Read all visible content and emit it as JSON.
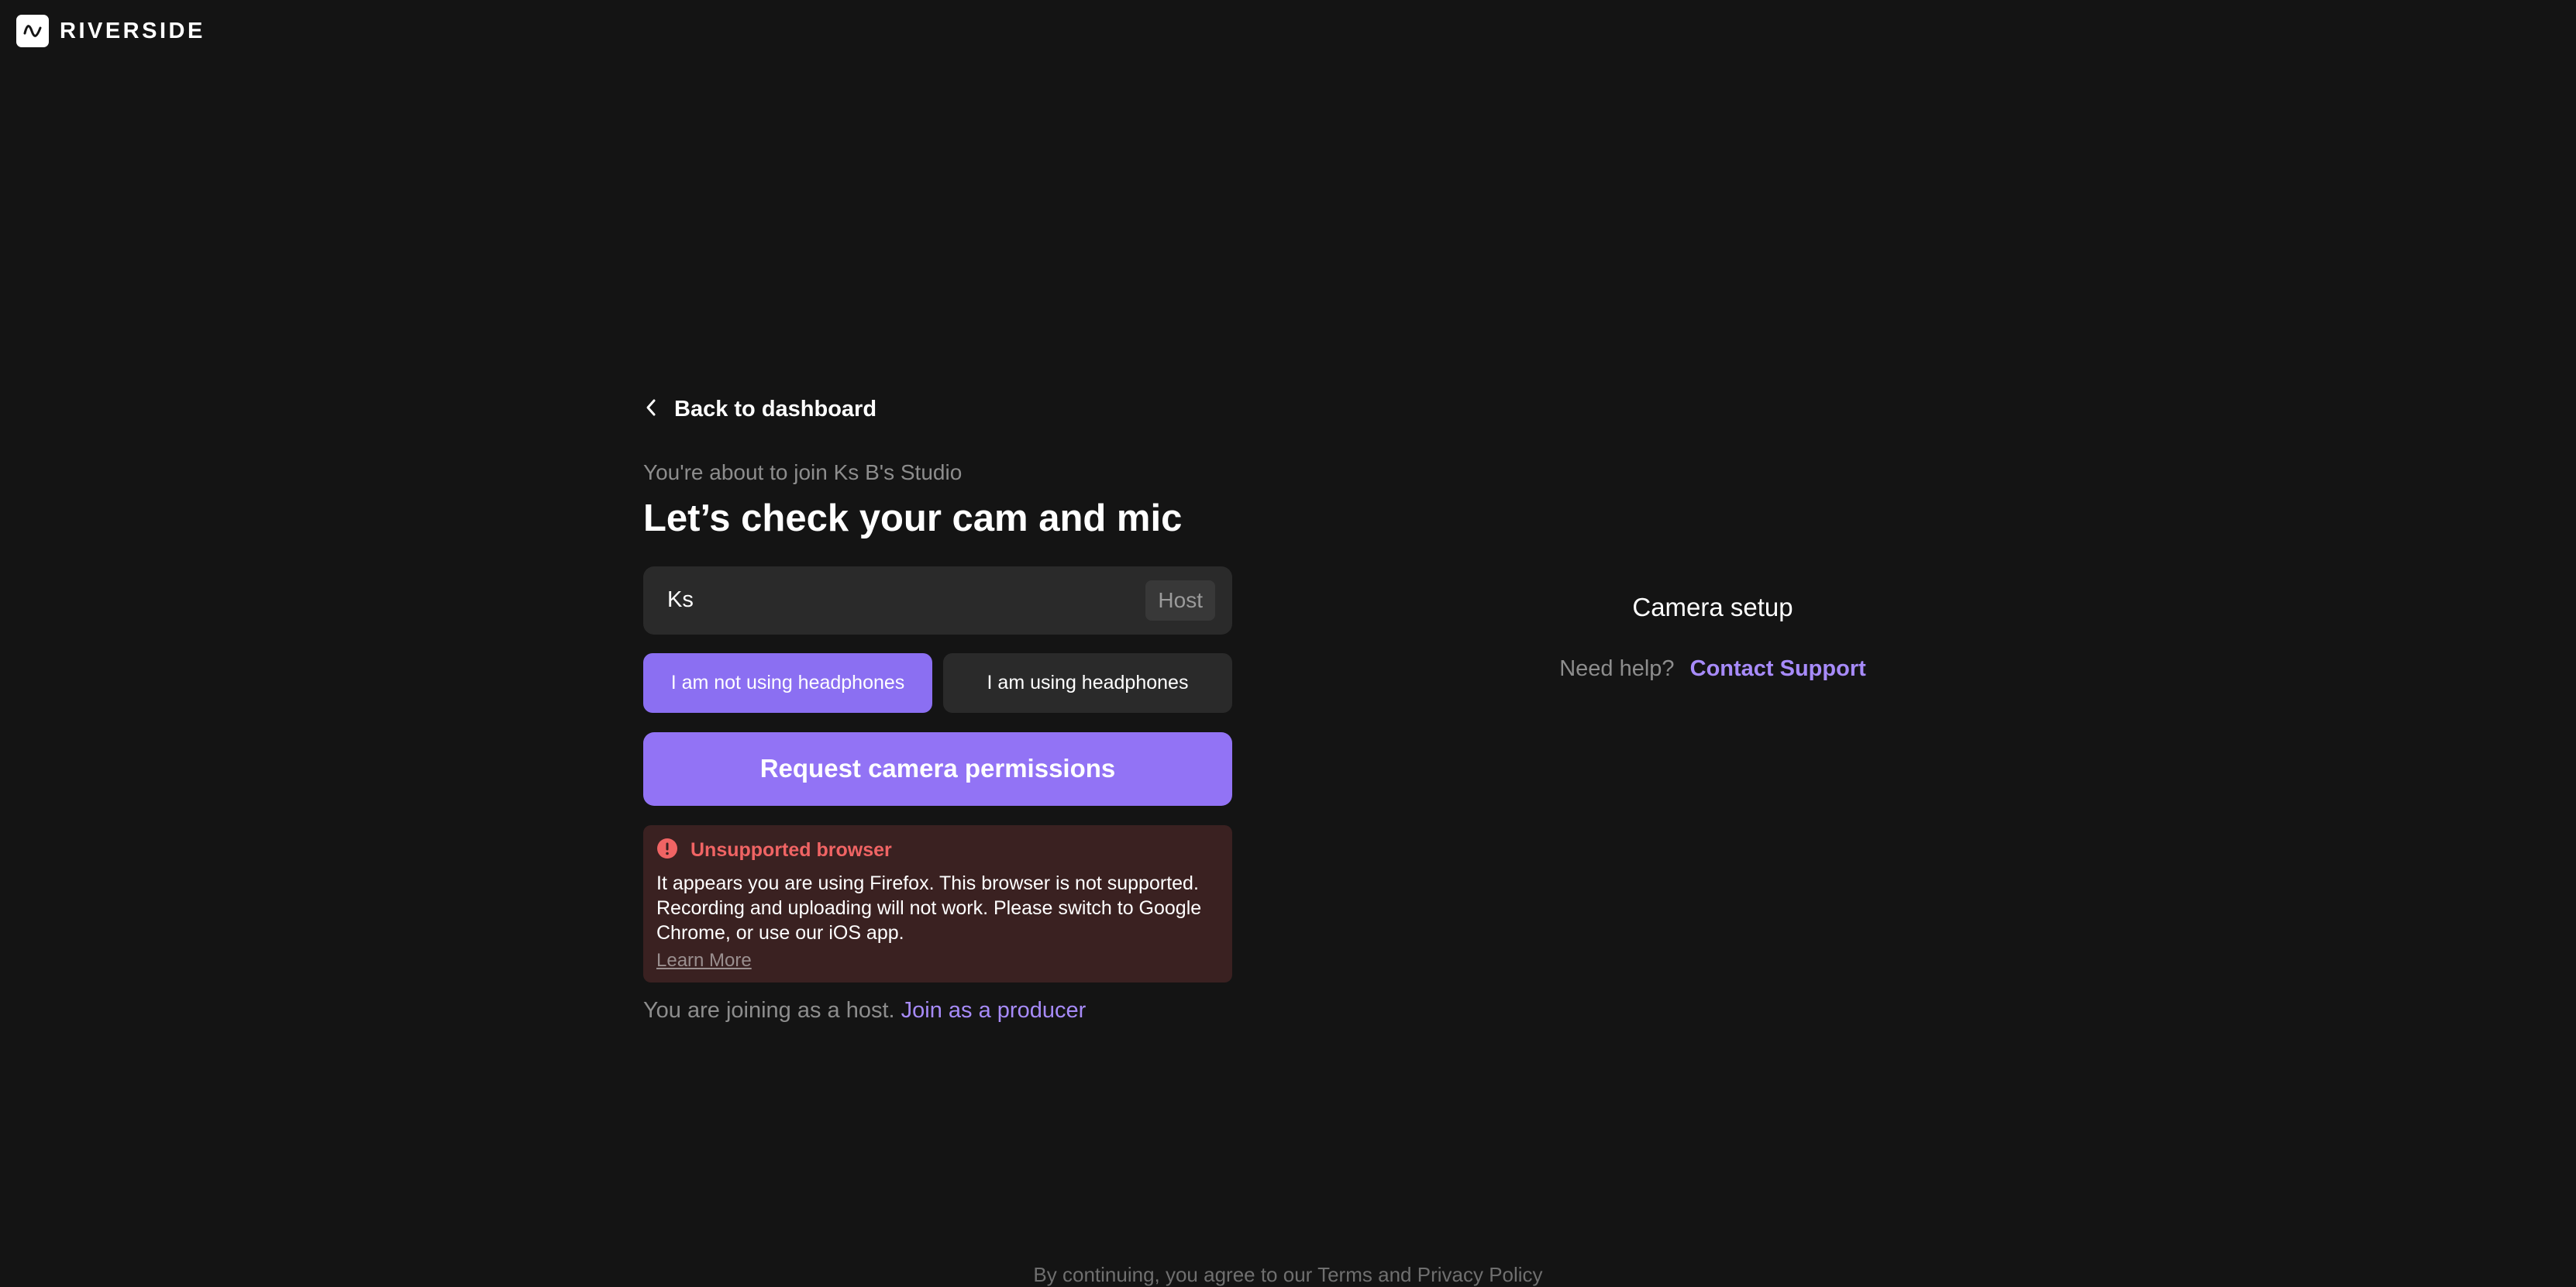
{
  "brand": {
    "name": "RIVERSIDE",
    "logo_icon": "riverside-wave-icon"
  },
  "nav": {
    "back_label": "Back to dashboard",
    "back_icon": "chevron-left-icon"
  },
  "studio": {
    "subtitle": "You're about to join Ks B's Studio",
    "title": "Let’s check your cam and mic"
  },
  "name_field": {
    "value": "Ks",
    "role": "Host"
  },
  "headphones": {
    "options": [
      "I am not using headphones",
      "I am using headphones"
    ],
    "selected": "I am not using headphones"
  },
  "primary_action": {
    "label": "Request camera permissions"
  },
  "alert": {
    "icon": "error-icon",
    "title": "Unsupported browser",
    "body": "It appears you are using Firefox. This browser is not supported. Recording and uploading will not work. Please switch to Google Chrome, or use our iOS app.",
    "link": "Learn More"
  },
  "join": {
    "text": "You are joining as a host.",
    "link": "Join as a producer"
  },
  "camera": {
    "title": "Camera setup",
    "help_text": "Need help?",
    "help_link": "Contact Support"
  },
  "footer": {
    "prefix": "By continuing, you agree to our",
    "terms": "Terms",
    "and": "and",
    "privacy": "Privacy Policy"
  },
  "colors": {
    "background": "#141414",
    "accent": "#9273f5",
    "link": "#a78bfa",
    "error": "#f06464"
  }
}
